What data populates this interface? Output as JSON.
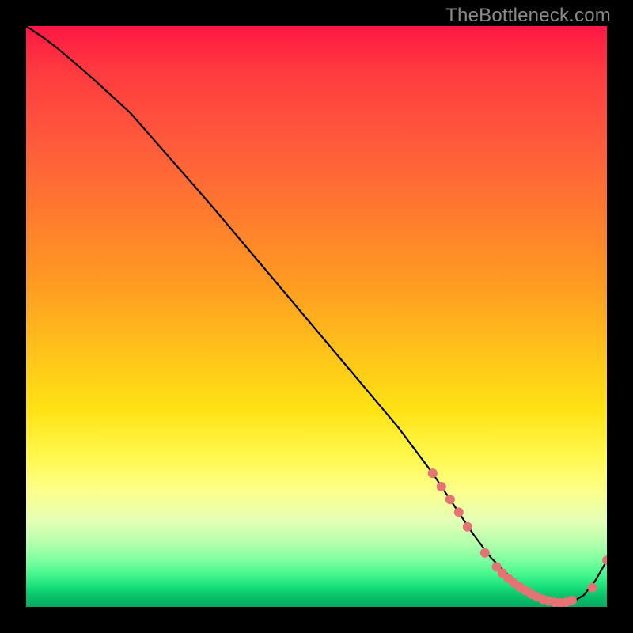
{
  "watermark": "TheBottleneck.com",
  "chart_data": {
    "type": "line",
    "title": "",
    "xlabel": "",
    "ylabel": "",
    "xlim": [
      0,
      100
    ],
    "ylim": [
      0,
      100
    ],
    "grid": false,
    "legend": false,
    "series": [
      {
        "name": "bottleneck-curve",
        "color": "#000000",
        "x": [
          0,
          3,
          5,
          8,
          12,
          18,
          25,
          32,
          40,
          48,
          56,
          64,
          70,
          74,
          77,
          80,
          83,
          86,
          88,
          90,
          92,
          94,
          96,
          98,
          100
        ],
        "y": [
          100,
          98,
          96.5,
          94,
          90.5,
          85,
          77,
          69,
          59.5,
          50,
          40.5,
          31,
          23,
          17,
          12.5,
          8.5,
          5.5,
          3.2,
          1.8,
          1.0,
          0.6,
          0.8,
          2.0,
          4.5,
          8
        ]
      }
    ],
    "markers": [
      {
        "name": "highlight-points",
        "color": "#e57373",
        "points": [
          {
            "x": 70.0,
            "y": 23.0
          },
          {
            "x": 71.5,
            "y": 20.7
          },
          {
            "x": 73.0,
            "y": 18.5
          },
          {
            "x": 74.5,
            "y": 16.3
          },
          {
            "x": 76.0,
            "y": 13.8
          },
          {
            "x": 79.0,
            "y": 9.3
          },
          {
            "x": 81.0,
            "y": 6.9
          },
          {
            "x": 82.0,
            "y": 5.8
          },
          {
            "x": 83.0,
            "y": 4.9
          },
          {
            "x": 84.0,
            "y": 4.1
          },
          {
            "x": 85.0,
            "y": 3.4
          },
          {
            "x": 86.0,
            "y": 2.8
          },
          {
            "x": 87.0,
            "y": 2.2
          },
          {
            "x": 88.0,
            "y": 1.7
          },
          {
            "x": 89.0,
            "y": 1.3
          },
          {
            "x": 90.0,
            "y": 1.0
          },
          {
            "x": 91.0,
            "y": 0.8
          },
          {
            "x": 92.0,
            "y": 0.7
          },
          {
            "x": 93.0,
            "y": 0.8
          },
          {
            "x": 94.0,
            "y": 1.1
          },
          {
            "x": 97.5,
            "y": 3.3
          },
          {
            "x": 100.0,
            "y": 8.0
          }
        ]
      }
    ],
    "annotations": [
      {
        "text": "",
        "x": 86,
        "y": 4
      }
    ],
    "background_gradient": {
      "direction": "vertical",
      "stops": [
        {
          "pos": 0.0,
          "color": "#ff1744"
        },
        {
          "pos": 0.4,
          "color": "#ff9a22"
        },
        {
          "pos": 0.7,
          "color": "#fff84c"
        },
        {
          "pos": 0.9,
          "color": "#7dff9f"
        },
        {
          "pos": 1.0,
          "color": "#00aa5e"
        }
      ]
    }
  }
}
